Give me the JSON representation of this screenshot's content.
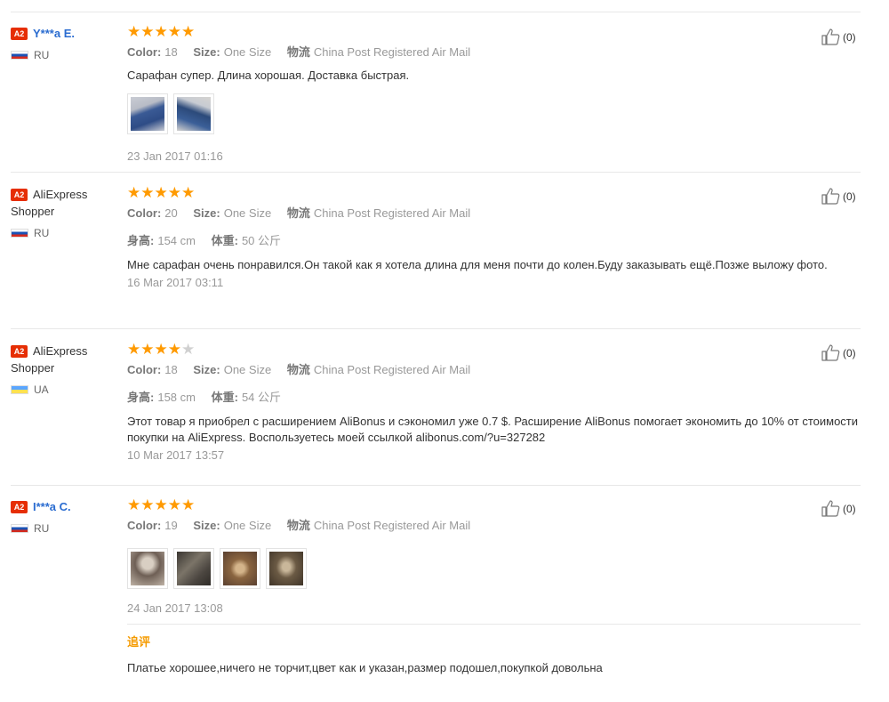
{
  "reviews": [
    {
      "badge": "A2",
      "name": "Y***a E.",
      "name_style": "link",
      "country": "RU",
      "flag": "ru",
      "rating": 5,
      "color_label": "Color:",
      "color": "18",
      "size_label": "Size:",
      "size": "One Size",
      "shipping_label": "物流",
      "shipping": "China Post Registered Air Mail",
      "text": "Сарафан супер. Длина хорошая. Доставка быстрая.",
      "photos": [
        {
          "name": "review-photo-1",
          "colors": [
            "#c9ccd4",
            "#3a5a95",
            "#b8bcc6"
          ]
        },
        {
          "name": "review-photo-2",
          "colors": [
            "#d5d3d0",
            "#2c4a7a",
            "#c8ccd3"
          ]
        }
      ],
      "date": "23 Jan 2017 01:16",
      "likes": "(0)"
    },
    {
      "badge": "A2",
      "name": "AliExpress Shopper",
      "name_style": "plain",
      "country": "RU",
      "flag": "ru",
      "rating": 5,
      "color_label": "Color:",
      "color": "20",
      "size_label": "Size:",
      "size": "One Size",
      "shipping_label": "物流",
      "shipping": "China Post Registered Air Mail",
      "height_label": "身高:",
      "height": "154 cm",
      "weight_label": "体重:",
      "weight": "50 公斤",
      "text": "Мне сарафан очень понравился.Он такой как я хотела длина для меня почти до колен.Буду заказывать ещё.Позже выложу фото.",
      "date": "16 Mar 2017 03:11",
      "likes": "(0)"
    },
    {
      "badge": "A2",
      "name": "AliExpress Shopper",
      "name_style": "plain",
      "country": "UA",
      "flag": "ua",
      "rating": 4,
      "color_label": "Color:",
      "color": "18",
      "size_label": "Size:",
      "size": "One Size",
      "shipping_label": "物流",
      "shipping": "China Post Registered Air Mail",
      "height_label": "身高:",
      "height": "158 cm",
      "weight_label": "体重:",
      "weight": "54 公斤",
      "text": "Этот товар я приобрел с расширением AliBonus и сэкономил уже 0.7 $. Расширение AliBonus помогает экономить до 10% от стоимости покупки на AliExpress. Воспользуетесь моей ссылкой alibonus.com/?u=327282",
      "date": "10 Mar 2017 13:57",
      "likes": "(0)"
    },
    {
      "badge": "A2",
      "name": "I***a C.",
      "name_style": "link",
      "country": "RU",
      "flag": "ru",
      "rating": 5,
      "color_label": "Color:",
      "color": "19",
      "size_label": "Size:",
      "size": "One Size",
      "shipping_label": "物流",
      "shipping": "China Post Registered Air Mail",
      "photos": [
        {
          "name": "review-photo-1",
          "colors": [
            "#bfb3a6",
            "#6e5f55",
            "#d9cfc3"
          ]
        },
        {
          "name": "review-photo-2",
          "colors": [
            "#4b4640",
            "#7b7468",
            "#3a3631"
          ]
        },
        {
          "name": "review-photo-3",
          "colors": [
            "#8a6540",
            "#d4b48a",
            "#5a4030"
          ]
        },
        {
          "name": "review-photo-4",
          "colors": [
            "#6b5a44",
            "#c9b79a",
            "#3f3428"
          ]
        }
      ],
      "date": "24 Jan 2017 13:08",
      "likes": "(0)",
      "followup_label": "追评",
      "followup_text": "Платье хорошее,ничего не торчит,цвет как и указан,размер подошел,покупкой довольна"
    }
  ],
  "colors": {
    "star_on": "#ff9a00",
    "star_off": "#d0d0d0",
    "badge": "#e62e04",
    "link": "#2a6cd0",
    "followup": "#f59b00"
  }
}
